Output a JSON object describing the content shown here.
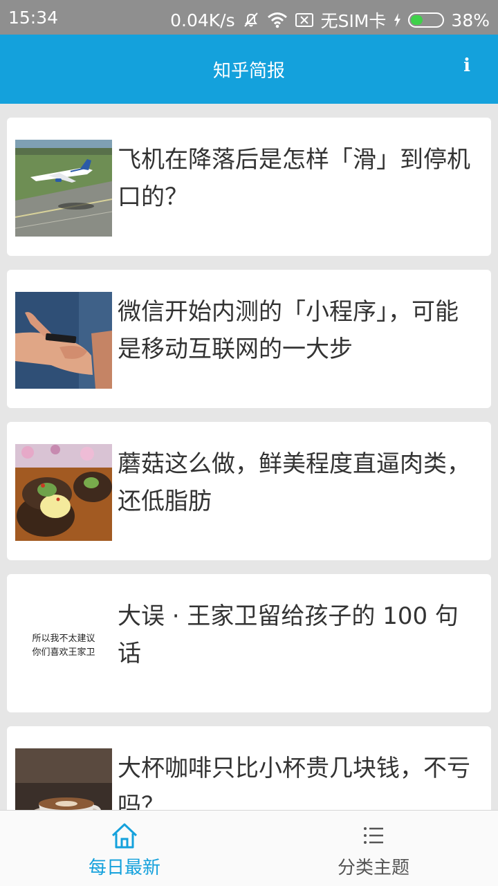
{
  "status_bar": {
    "time": "15:34",
    "net_speed": "0.04K/s",
    "sim_text": "无SIM卡",
    "battery_text": "38%",
    "battery_level": 0.38,
    "icons": [
      "bell-off-icon",
      "wifi-icon",
      "sim-x-icon",
      "charging-icon",
      "battery-icon"
    ]
  },
  "app_bar": {
    "title": "知乎简报",
    "info_label": "i"
  },
  "feed": {
    "items": [
      {
        "title": "飞机在降落后是怎样「滑」到停机口的？",
        "image": "airplane-runway-photo"
      },
      {
        "title": "微信开始内测的「小程序」，可能是移动互联网的一大步",
        "image": "hand-holding-phone-photo"
      },
      {
        "title": "蘑菇这么做，鲜美程度直逼肉类，还低脂肪",
        "image": "stuffed-mushrooms-photo"
      },
      {
        "title": "大误 · 王家卫留给孩子的 100 句话",
        "image": "text-image",
        "image_text": [
          "所以我不太建议",
          "你们喜欢王家卫"
        ]
      },
      {
        "title": "大杯咖啡只比小杯贵几块钱，不亏吗？",
        "image": "coffee-cup-photo"
      }
    ]
  },
  "bottom_nav": {
    "tabs": [
      {
        "label": "每日最新",
        "icon": "home-icon",
        "active": true
      },
      {
        "label": "分类主题",
        "icon": "list-icon",
        "active": false
      }
    ],
    "active_color": "#14a1dc",
    "inactive_color": "#555555"
  },
  "colors": {
    "primary": "#14a1dc",
    "status_bar": "#8f8f8f",
    "background": "#e6e6e6",
    "card": "#ffffff",
    "headline_text": "#333333"
  }
}
